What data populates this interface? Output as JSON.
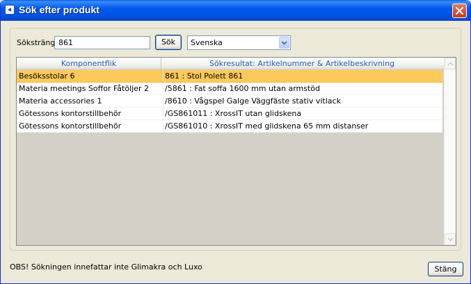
{
  "window": {
    "title": "Sök efter produkt",
    "close_tooltip_icon": "close-icon"
  },
  "search": {
    "label": "Söksträng",
    "value": "861",
    "button_label": "Sök",
    "language": "Svenska"
  },
  "results": {
    "columns": [
      "Komponentflik",
      "Sökresultat: Artikelnummer & Artikelbeskrivning"
    ],
    "rows": [
      {
        "component": "Besöksstolar 6",
        "result": "861 : Stol Polett 861",
        "selected": true
      },
      {
        "component": "Materia meetings Soffor Fåtöljer 2",
        "result": "/5861 : Fat soffa 1600 mm utan armstöd",
        "selected": false
      },
      {
        "component": "Materia accessories 1",
        "result": "/8610 : Vågspel Galge Väggfäste stativ vitlack",
        "selected": false
      },
      {
        "component": "Götessons kontorstillbehör",
        "result": "/GS861011 : XrossIT utan glidskena",
        "selected": false
      },
      {
        "component": "Götessons kontorstillbehör",
        "result": "/GS861010 : XrossIT med glidskena 65 mm distanser",
        "selected": false
      }
    ]
  },
  "footer": {
    "note": "OBS! Sökningen innefattar inte Glimakra och Luxo",
    "close_label": "Stäng"
  },
  "colors": {
    "titlebar": "#0054E3",
    "selected_row": "#FDC95A",
    "header_text": "#1F5FB8"
  }
}
